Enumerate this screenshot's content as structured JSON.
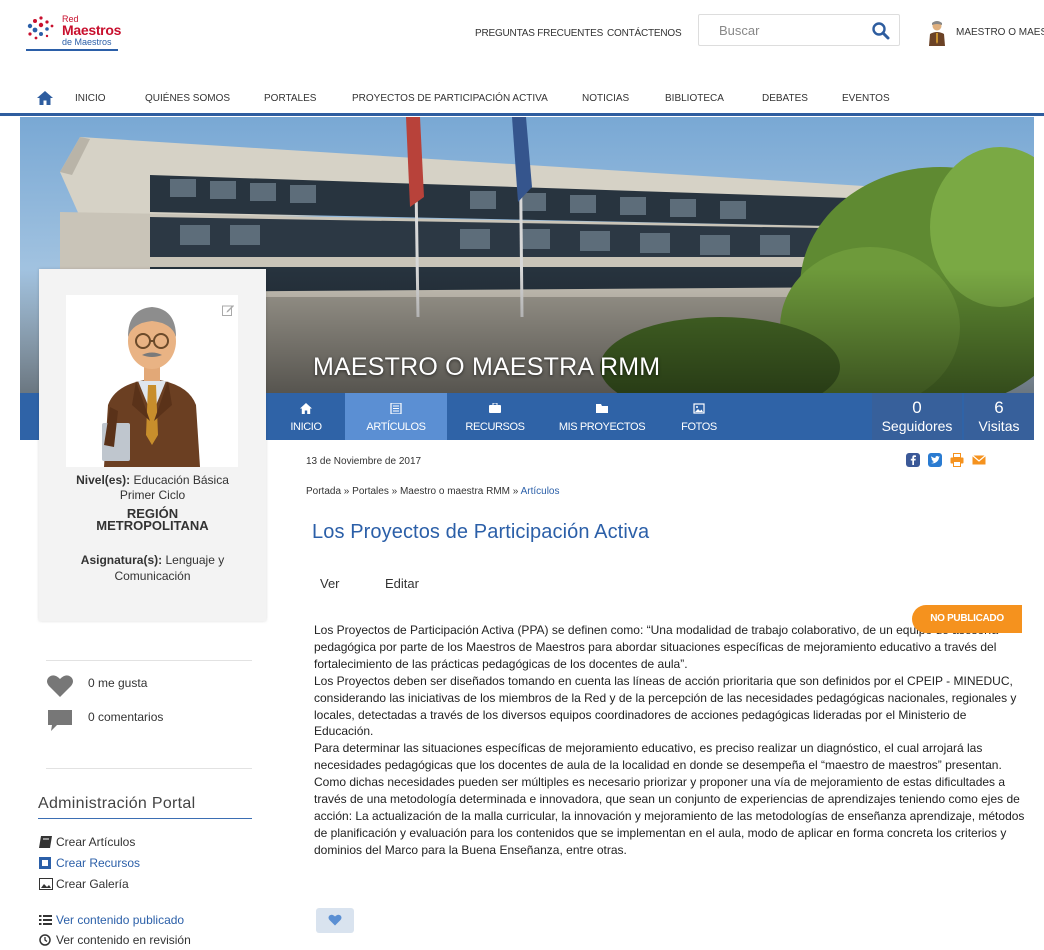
{
  "header": {
    "logo": {
      "line1": "Red",
      "line2": "Maestros",
      "line3": "de Maestros"
    },
    "links": [
      "PREGUNTAS FRECUENTES",
      "CONTÁCTENOS"
    ],
    "search_placeholder": "Buscar",
    "user_name": "MAESTRO O MAESTRA RMM"
  },
  "nav": {
    "items": [
      "INICIO",
      "QUIÉNES SOMOS",
      "PORTALES",
      "PROYECTOS DE PARTICIPACIÓN ACTIVA",
      "NOTICIAS",
      "BIBLIOTECA",
      "DEBATES",
      "EVENTOS"
    ]
  },
  "hero": {
    "title": "MAESTRO O MAESTRA RMM"
  },
  "tabs": [
    {
      "label": "INICIO",
      "icon": "home-icon",
      "active": false
    },
    {
      "label": "ARTÍCULOS",
      "icon": "articles-icon",
      "active": true
    },
    {
      "label": "RECURSOS",
      "icon": "resources-icon",
      "active": false
    },
    {
      "label": "MIS PROYECTOS",
      "icon": "folder-icon",
      "active": false
    },
    {
      "label": "FOTOS",
      "icon": "photos-icon",
      "active": false
    }
  ],
  "stats": [
    {
      "value": "0",
      "label": "Seguidores"
    },
    {
      "value": "6",
      "label": "Visitas"
    }
  ],
  "profile": {
    "nivel_label": "Nivel(es):",
    "nivel_value": "Educación Básica",
    "nivel_value2": "Primer Ciclo",
    "region_line1": "REGIÓN",
    "region_line2": "METROPOLITANA",
    "asignatura_label": "Asignatura(s):",
    "asignatura_value": "Lenguaje y",
    "asignatura_value2": "Comunicación"
  },
  "social": {
    "likes": "0 me gusta",
    "comments": "0 comentarios"
  },
  "admin": {
    "title": "Administración Portal",
    "links": [
      {
        "label": "Crear Artículos",
        "icon": "book-icon",
        "color": "#333333"
      },
      {
        "label": "Crear Recursos",
        "icon": "resource-icon",
        "color": "#2b5fa8"
      },
      {
        "label": "Crear Galería",
        "icon": "image-icon",
        "color": "#333333"
      },
      {
        "label": "Ver contenido publicado",
        "icon": "list-icon",
        "color": "#2b5fa8"
      },
      {
        "label": "Ver contenido en revisión",
        "icon": "clock-icon",
        "color": "#333333"
      }
    ]
  },
  "article": {
    "date": "13 de Noviembre de 2017",
    "breadcrumb": {
      "portada": "Portada",
      "portales": "Portales",
      "maestro": "Maestro o maestra RMM",
      "articulos": "Artículos",
      "sep": " » "
    },
    "title": "Los Proyectos de Participación Activa",
    "tab_ver": "Ver",
    "tab_editar": "Editar",
    "status_badge": "NO PUBLICADO",
    "paragraphs": [
      "Los Proyectos de Participación Activa (PPA) se definen como: “Una modalidad de trabajo colaborativo, de un equipo de asesoría pedagógica por parte de los Maestros de Maestros para abordar situaciones específicas de mejoramiento educativo a través del fortalecimiento de las prácticas pedagógicas de los docentes de aula”.",
      "Los Proyectos deben ser diseñados tomando en cuenta las líneas de acción prioritaria que son definidos por el CPEIP - MINEDUC, considerando las iniciativas de los miembros de la Red y de la percepción de las necesidades pedagógicas nacionales, regionales y locales, detectadas a través de los diversos equipos coordinadores de acciones pedagógicas lideradas por el Ministerio de Educación.",
      "Para determinar las situaciones específicas de mejoramiento educativo, es preciso realizar un diagnóstico, el cual arrojará las necesidades pedagógicas que los docentes de aula de la localidad en donde se desempeña el “maestro de maestros” presentan. Como dichas necesidades pueden ser múltiples es necesario priorizar y proponer una vía de mejoramiento de estas dificultades a través de una metodología determinada e innovadora, que sean un conjunto de experiencias de aprendizajes teniendo como ejes de acción: La actualización de la malla curricular, la innovación y mejoramiento de las metodologías de enseñanza aprendizaje, métodos de planificación y evaluación para los contenidos que se implementan en el aula, modo de aplicar en forma concreta los criterios y dominios del Marco para la Buena Enseñanza, entre otras."
    ]
  },
  "colors": {
    "brand_blue": "#2f63a7",
    "active_tab": "#5b8fd3",
    "title_blue": "#2b5fa8",
    "badge_orange": "#f5921e"
  }
}
